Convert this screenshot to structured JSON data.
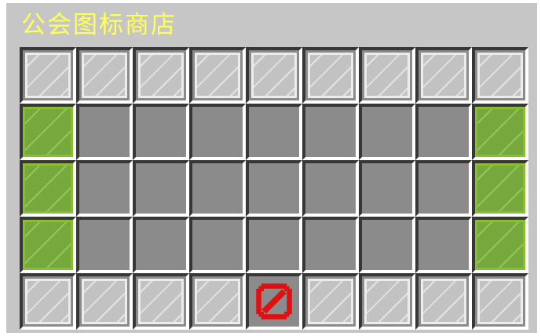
{
  "window": {
    "title": "公会图标商店",
    "title_color": "#ffff55"
  },
  "inventory": {
    "columns": 9,
    "rows": 5,
    "slots": [
      "gray-glass-pane",
      "gray-glass-pane",
      "gray-glass-pane",
      "gray-glass-pane",
      "gray-glass-pane",
      "gray-glass-pane",
      "gray-glass-pane",
      "gray-glass-pane",
      "gray-glass-pane",
      "lime-glass-pane",
      "empty",
      "empty",
      "empty",
      "empty",
      "empty",
      "empty",
      "empty",
      "lime-glass-pane",
      "lime-glass-pane",
      "empty",
      "empty",
      "empty",
      "empty",
      "empty",
      "empty",
      "empty",
      "lime-glass-pane",
      "lime-glass-pane",
      "empty",
      "empty",
      "empty",
      "empty",
      "empty",
      "empty",
      "empty",
      "lime-glass-pane",
      "gray-glass-pane",
      "gray-glass-pane",
      "gray-glass-pane",
      "gray-glass-pane",
      "barrier",
      "gray-glass-pane",
      "gray-glass-pane",
      "gray-glass-pane",
      "gray-glass-pane"
    ]
  },
  "colors": {
    "window_background": "#c6c6c6",
    "slot_background": "#8b8b8b",
    "gray_pane": "#c2c2c2",
    "lime_pane": "#76a93d",
    "barrier_red": "#e01010"
  }
}
